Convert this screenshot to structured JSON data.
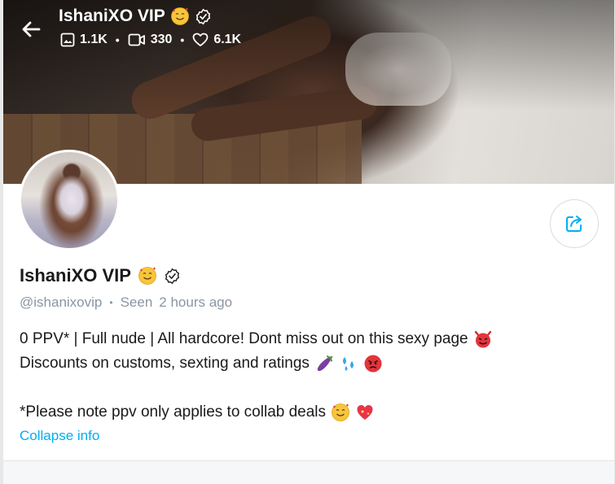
{
  "header": {
    "name": "IshaniXO VIP",
    "stats": {
      "photos": "1.1K",
      "videos": "330",
      "likes": "6.1K"
    },
    "stat_separator": "•"
  },
  "profile": {
    "name": "IshaniXO VIP",
    "handle": "@ishanixovip",
    "separator": "•",
    "seen_label": "Seen",
    "seen_time": "2 hours ago"
  },
  "bio": {
    "line1": "0 PPV* | Full nude | All hardcore! Dont miss out on this sexy page",
    "line2": "Discounts on customs, sexting and ratings",
    "line3": "*Please note ppv only applies to collab deals"
  },
  "actions": {
    "collapse_label": "Collapse info"
  },
  "colors": {
    "accent": "#00aff0",
    "muted": "#8a96a3",
    "text": "#1a1a1a"
  },
  "icons": {
    "back": "arrow-left-icon",
    "verified": "verified-badge-icon",
    "photo": "image-icon",
    "video": "video-icon",
    "like": "heart-icon",
    "share": "share-icon"
  }
}
